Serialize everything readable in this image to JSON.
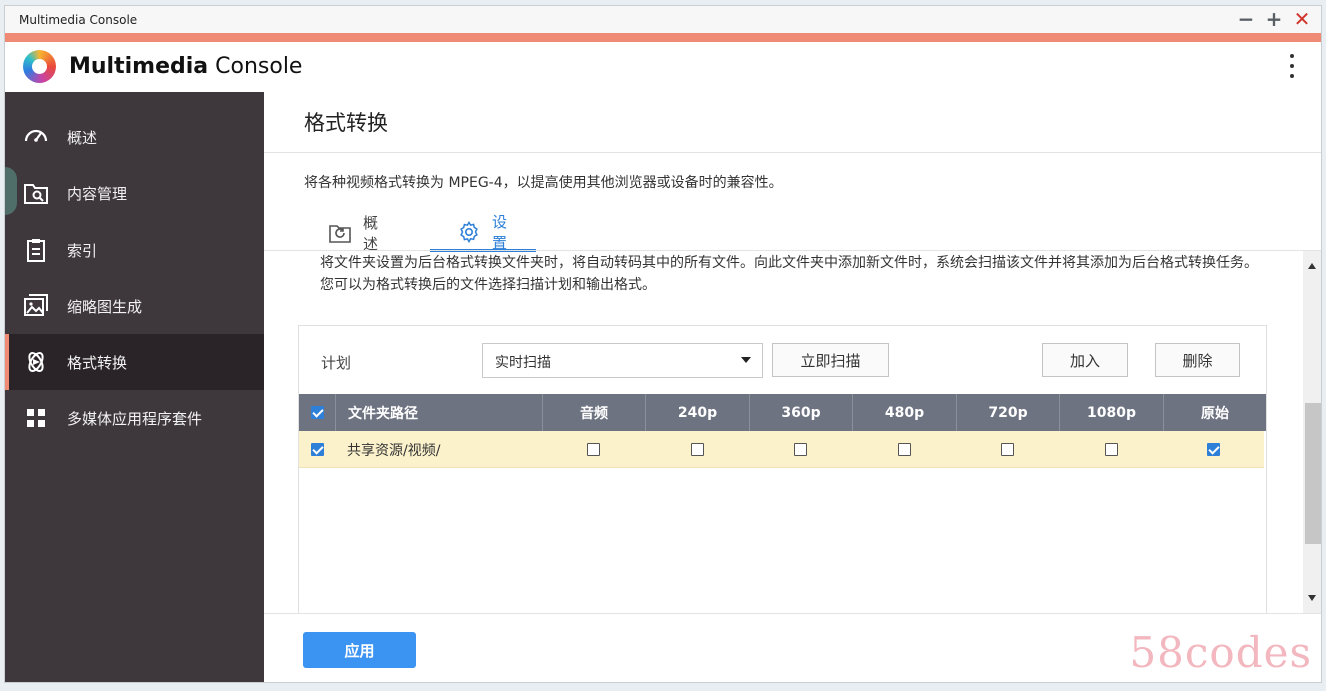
{
  "window": {
    "title": "Multimedia Console",
    "minimize": "−",
    "maximize": "+",
    "close": "✕"
  },
  "app": {
    "name_bold": "Multimedia",
    "name_rest": " Console"
  },
  "sidebar": {
    "items": [
      {
        "label": "概述",
        "icon": "speedometer-icon"
      },
      {
        "label": "内容管理",
        "icon": "folder-search-icon"
      },
      {
        "label": "索引",
        "icon": "clipboard-icon"
      },
      {
        "label": "缩略图生成",
        "icon": "image-icon"
      },
      {
        "label": "格式转换",
        "icon": "transcode-icon",
        "active": true
      },
      {
        "label": "多媒体应用程序套件",
        "icon": "apps-grid-icon"
      }
    ]
  },
  "main": {
    "title": "格式转换",
    "description": "将各种视频格式转换为 MPEG-4，以提高使用其他浏览器或设备时的兼容性。",
    "tabs": [
      {
        "label": "概述",
        "icon": "folder-refresh-icon"
      },
      {
        "label": "设置",
        "icon": "gear-icon",
        "active": true
      }
    ],
    "info_text": "将文件夹设置为后台格式转换文件夹时，将自动转码其中的所有文件。向此文件夹中添加新文件时，系统会扫描该文件并将其添加为后台格式转换任务。您可以为格式转换后的文件选择扫描计划和输出格式。",
    "plan_label": "计划",
    "plan_value": "实时扫描",
    "scan_now": "立即扫描",
    "add": "加入",
    "delete": "删除",
    "table": {
      "headers": [
        "文件夹路径",
        "音频",
        "240p",
        "360p",
        "480p",
        "720p",
        "1080p",
        "原始"
      ],
      "rows": [
        {
          "checked": true,
          "path": "共享资源/视频/",
          "flags": [
            false,
            false,
            false,
            false,
            false,
            false,
            true
          ]
        }
      ]
    },
    "apply": "应用"
  },
  "watermark": "58codes",
  "colors": {
    "accent": "#ef8a74",
    "sidebar": "#3e373c",
    "primary": "#2d7fd8",
    "table_header": "#6e7382",
    "selected_row": "#fbf2cc"
  }
}
